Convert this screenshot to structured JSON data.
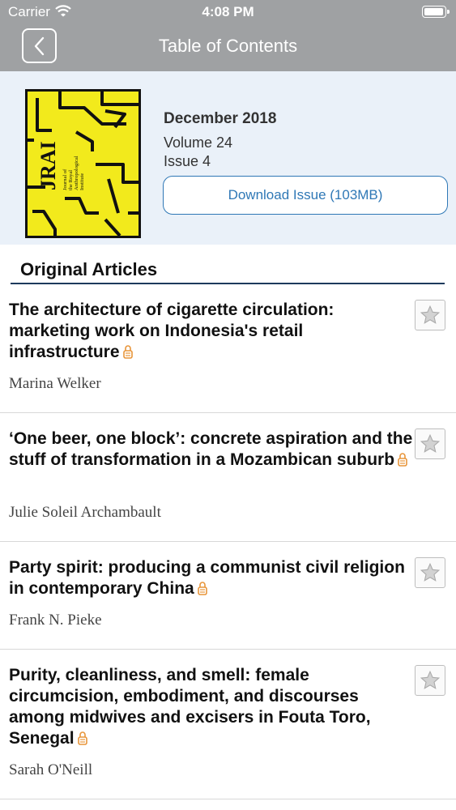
{
  "status": {
    "carrier": "Carrier",
    "time": "4:08 PM"
  },
  "nav": {
    "title": "Table of Contents"
  },
  "issue": {
    "date": "December 2018",
    "volume": "Volume 24",
    "issue": "Issue 4",
    "download_label": "Download Issue (103MB)",
    "cover": {
      "logo": "JRAI",
      "subtitle": "Journal of the Royal Anthropological Institute",
      "colors": {
        "background": "#f2ea1c",
        "lines": "#111111"
      }
    }
  },
  "section": {
    "title": "Original Articles"
  },
  "articles": [
    {
      "title": "The architecture of cigarette circulation: marketing work on Indonesia's retail infrastructure",
      "author": "Marina Welker",
      "locked": true
    },
    {
      "title": "‘One beer, one block’: concrete aspiration and the stuff of transformation in a Mozambican suburb",
      "author": "Julie Soleil Archambault",
      "locked": true
    },
    {
      "title": "Party spirit: producing a communist civil religion in contemporary China",
      "author": "Frank N. Pieke",
      "locked": true
    },
    {
      "title": "Purity, cleanliness, and smell: female circumcision, embodiment, and discourses among midwives and excisers in Fouta Toro, Senegal",
      "author": "Sarah O'Neill",
      "locked": true
    }
  ],
  "colors": {
    "bar": "#9fa1a3",
    "panel": "#eaf1f9",
    "accent": "#2f78b6",
    "lock": "#e8953a"
  }
}
